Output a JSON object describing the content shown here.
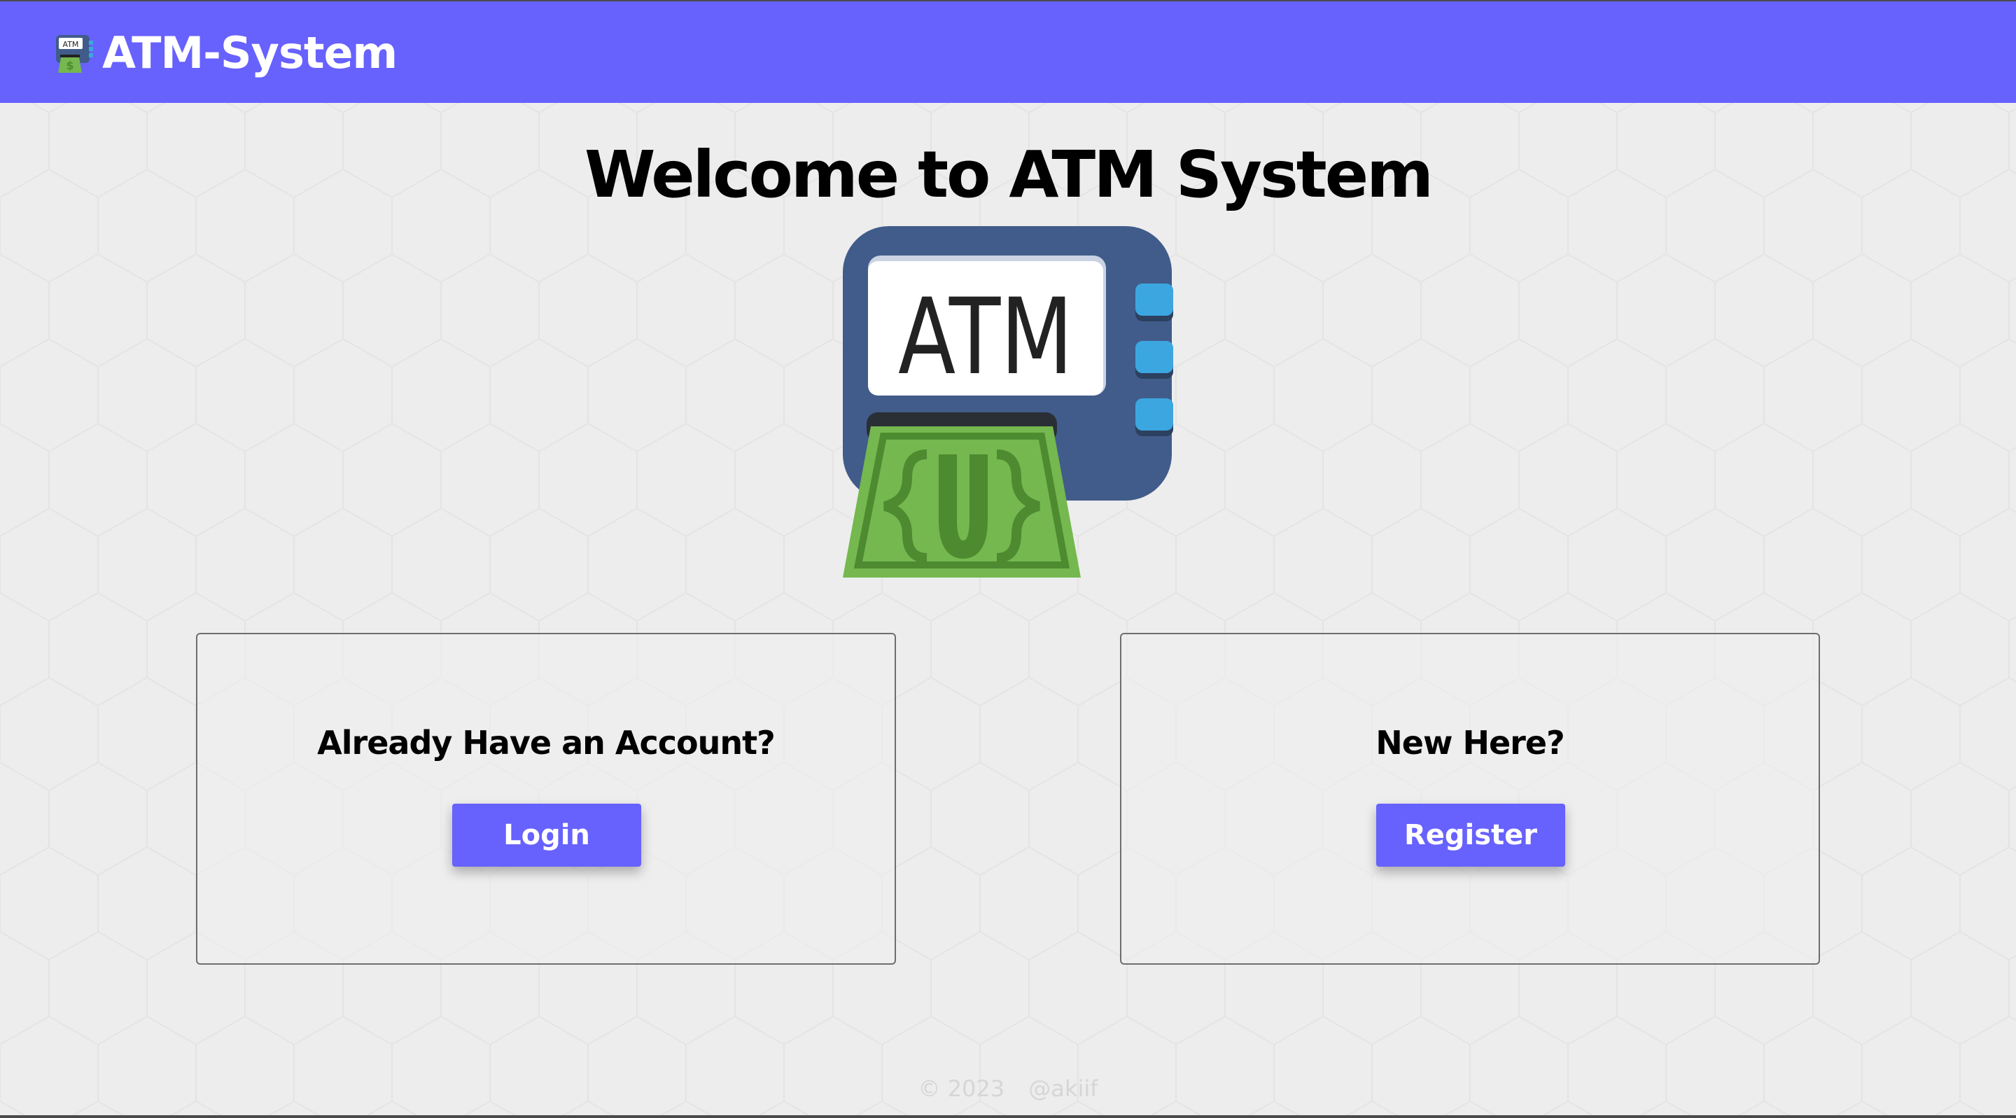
{
  "navbar": {
    "logo_icon": "atm-cash-icon",
    "brand": "ATM-System",
    "icon_label": "ATM",
    "color": "#6761fe"
  },
  "hero": {
    "title": "Welcome to ATM System",
    "illustration": "atm-machine-icon",
    "screen_text": "ATM"
  },
  "cards": {
    "login": {
      "heading": "Already Have an Account?",
      "button_label": "Login"
    },
    "register": {
      "heading": "New Here?",
      "button_label": "Register"
    }
  },
  "footer": {
    "copyright": "© 2023",
    "handle": "@akiif"
  },
  "colors": {
    "accent": "#6761fe",
    "background": "#ededed",
    "atm_body": "#415c8a",
    "atm_keys": "#3ca6e0",
    "cash_green": "#74b84f"
  }
}
